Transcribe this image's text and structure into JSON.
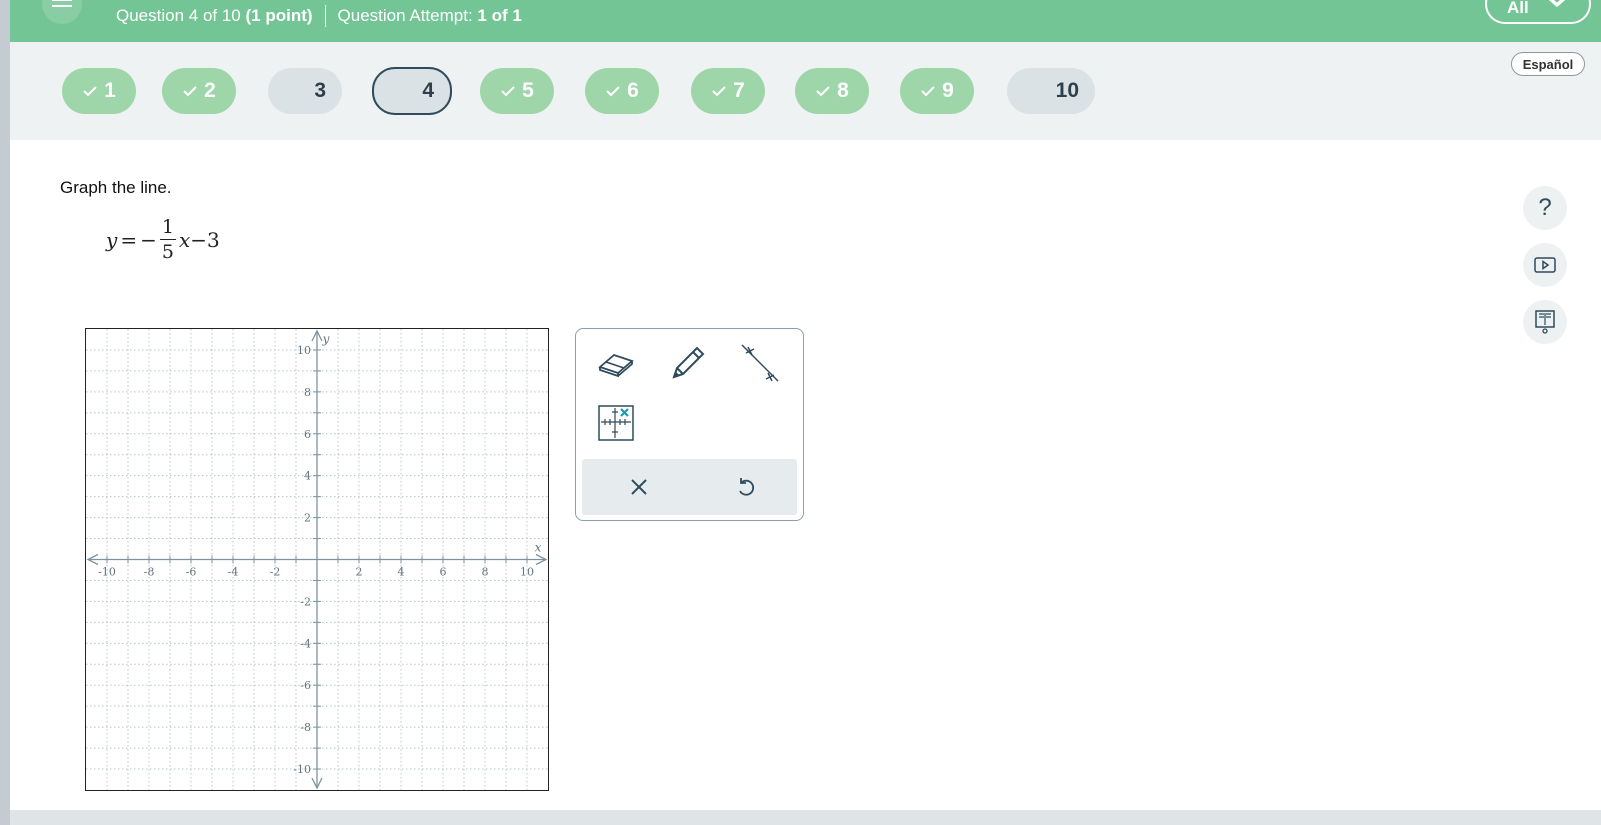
{
  "header": {
    "question_prefix": "Question 4 of 10",
    "question_points": "(1 point)",
    "attempt_prefix": "Question Attempt:",
    "attempt_value": "1 of 1",
    "filter_label": "All"
  },
  "question_nav": [
    {
      "label": "1",
      "status": "done"
    },
    {
      "label": "2",
      "status": "done"
    },
    {
      "label": "3",
      "status": "todo"
    },
    {
      "label": "4",
      "status": "current"
    },
    {
      "label": "5",
      "status": "done"
    },
    {
      "label": "6",
      "status": "done"
    },
    {
      "label": "7",
      "status": "done"
    },
    {
      "label": "8",
      "status": "done"
    },
    {
      "label": "9",
      "status": "done"
    },
    {
      "label": "10",
      "status": "todo"
    }
  ],
  "language_button": "Español",
  "question": {
    "prompt": "Graph the line.",
    "equation": {
      "lhs": "y",
      "equals": "=",
      "minus": "−",
      "numerator": "1",
      "denominator": "5",
      "variable": "x",
      "constant": "−3"
    }
  },
  "side_buttons": [
    "help-icon",
    "video-icon",
    "textbook-icon"
  ],
  "graph": {
    "x_label": "x",
    "y_label": "y",
    "x_range": [
      -11,
      11
    ],
    "y_range": [
      -11,
      11
    ],
    "x_ticks": [
      "-10",
      "-8",
      "-6",
      "-4",
      "-2",
      "2",
      "4",
      "6",
      "8",
      "10"
    ],
    "y_ticks": [
      "10",
      "8",
      "6",
      "4",
      "2",
      "-2",
      "-4",
      "-6",
      "-8",
      "-10"
    ]
  },
  "tools": [
    "eraser-icon",
    "pencil-icon",
    "line-tool-icon",
    "graph-point-icon"
  ],
  "actions": [
    "clear-icon",
    "undo-icon"
  ],
  "colors": {
    "header_green": "#74c595",
    "done_pill": "#9ed6aa",
    "todo_pill": "#dbe2e6",
    "axis_gray": "#7f939e",
    "accent_teal": "#1a9bb0"
  }
}
